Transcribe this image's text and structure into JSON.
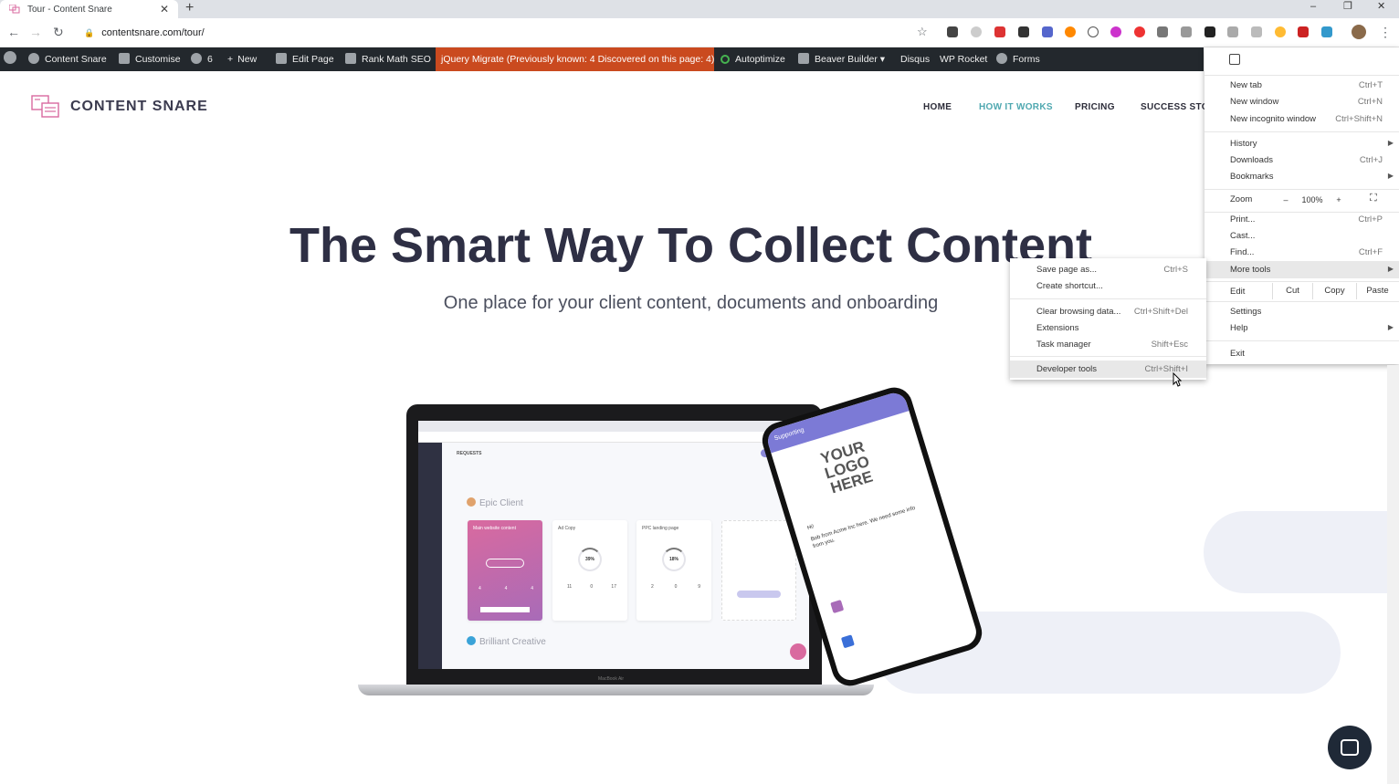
{
  "browser": {
    "tab_title": "Tour - Content Snare",
    "tab_close": "✕",
    "new_tab": "+",
    "url": "contentsnare.com/tour/",
    "window_controls": [
      "–",
      "❐",
      "✕"
    ]
  },
  "wp_admin_bar": {
    "site_name": "Content Snare",
    "customise": "Customise",
    "updates_count": "6",
    "new": "New",
    "edit_page": "Edit Page",
    "rank_math": "Rank Math SEO",
    "jquery_migrate": "jQuery Migrate (Previously known: 4 Discovered on this page: 4)",
    "autoptimize": "Autoptimize",
    "beaver_builder": "Beaver Builder ▾",
    "disqus": "Disqus",
    "wp_rocket": "WP Rocket",
    "forms": "Forms"
  },
  "site": {
    "logo_text": "CONTENT SNARE",
    "nav": [
      "HOME",
      "HOW IT WORKS",
      "PRICING",
      "SUCCESS STOR"
    ],
    "active_nav": "HOW IT WORKS",
    "hero_title": "The Smart Way To Collect Content",
    "hero_subtitle": "One place for your client content, documents and onboarding"
  },
  "laptop_mock": {
    "requests_label": "REQUESTS",
    "client1": "Epic Client",
    "client2": "Brilliant Creative",
    "cards": [
      {
        "title": "Main website content",
        "stats": [
          "4",
          "4",
          "4"
        ]
      },
      {
        "title": "Ad Copy",
        "percent": "39%",
        "stats": [
          "11",
          "0",
          "17"
        ]
      },
      {
        "title": "PPC landing page",
        "percent": "18%",
        "stats": [
          "2",
          "0",
          "9"
        ]
      }
    ],
    "brand": "MacBook Air"
  },
  "phone_mock": {
    "banner": "Supporting",
    "logo": "YOUR LOGO HERE",
    "greeting": "Hi!",
    "message": "Bob from Acme Inc here. We need some info from you."
  },
  "chrome_menu": {
    "items": [
      {
        "label": "New tab",
        "shortcut": "Ctrl+T"
      },
      {
        "label": "New window",
        "shortcut": "Ctrl+N"
      },
      {
        "label": "New incognito window",
        "shortcut": "Ctrl+Shift+N"
      },
      {
        "label": "History",
        "shortcut": ""
      },
      {
        "label": "Downloads",
        "shortcut": "Ctrl+J"
      },
      {
        "label": "Bookmarks",
        "shortcut": ""
      },
      {
        "label": "Zoom",
        "shortcut": ""
      },
      {
        "label": "Print...",
        "shortcut": "Ctrl+P"
      },
      {
        "label": "Cast...",
        "shortcut": ""
      },
      {
        "label": "Find...",
        "shortcut": "Ctrl+F"
      },
      {
        "label": "More tools",
        "shortcut": ""
      },
      {
        "label": "Edit",
        "shortcut": ""
      },
      {
        "label": "Settings",
        "shortcut": ""
      },
      {
        "label": "Help",
        "shortcut": ""
      },
      {
        "label": "Exit",
        "shortcut": ""
      }
    ],
    "zoom_minus": "–",
    "zoom_value": "100%",
    "zoom_plus": "+",
    "edit_cut": "Cut",
    "edit_copy": "Copy",
    "edit_paste": "Paste"
  },
  "more_tools_submenu": {
    "items": [
      {
        "label": "Save page as...",
        "shortcut": "Ctrl+S"
      },
      {
        "label": "Create shortcut...",
        "shortcut": ""
      },
      {
        "label": "Clear browsing data...",
        "shortcut": "Ctrl+Shift+Del"
      },
      {
        "label": "Extensions",
        "shortcut": ""
      },
      {
        "label": "Task manager",
        "shortcut": "Shift+Esc"
      },
      {
        "label": "Developer tools",
        "shortcut": "Ctrl+Shift+I"
      }
    ],
    "highlighted": "Developer tools"
  },
  "colors": {
    "wp_bar": "#23282d",
    "jquery_badge": "#ca4a1f",
    "accent_nav": "#4fa8b0",
    "hero_text": "#2e2f44",
    "chat_button": "#1f2937"
  },
  "icons": [
    "back-icon",
    "forward-icon",
    "reload-icon",
    "lock-icon",
    "star-icon",
    "kebab-menu-icon",
    "wordpress-icon",
    "chat-icon"
  ]
}
